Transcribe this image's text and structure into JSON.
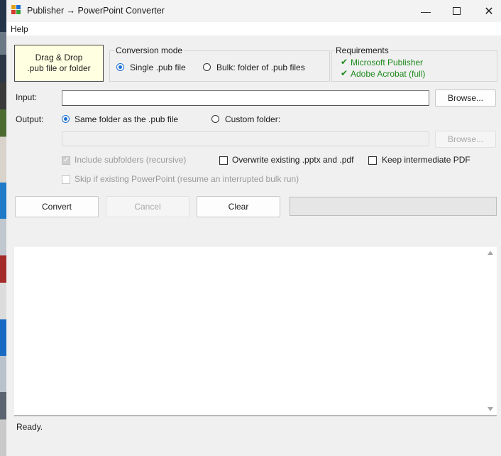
{
  "window": {
    "title": "Publisher → PowerPoint Converter",
    "minimize_icon": "minimize-icon",
    "maximize_icon": "maximize-icon",
    "close_icon": "close-icon"
  },
  "menu": {
    "help": "Help"
  },
  "dropzone": {
    "line1": "Drag & Drop",
    "line2": ".pub file or folder"
  },
  "mode": {
    "title": "Conversion mode",
    "single": "Single .pub file",
    "bulk": "Bulk: folder of .pub files",
    "selected": "single"
  },
  "requirements": {
    "title": "Requirements",
    "items": [
      "Microsoft Publisher",
      "Adobe Acrobat (full)"
    ],
    "status_color": "#1e8a1e"
  },
  "input": {
    "label": "Input:",
    "value": "",
    "browse": "Browse..."
  },
  "output": {
    "label": "Output:",
    "same_folder": "Same folder as the .pub file",
    "custom_folder": "Custom folder:",
    "selected": "same",
    "custom_value": "",
    "browse": "Browse..."
  },
  "options": {
    "include_subfolders": "Include subfolders (recursive)",
    "overwrite": "Overwrite existing .pptx and .pdf",
    "keep_pdf": "Keep intermediate PDF",
    "skip_existing": "Skip if existing PowerPoint (resume an interrupted bulk run)"
  },
  "actions": {
    "convert": "Convert",
    "cancel": "Cancel",
    "clear": "Clear"
  },
  "status": {
    "text": "Ready."
  }
}
